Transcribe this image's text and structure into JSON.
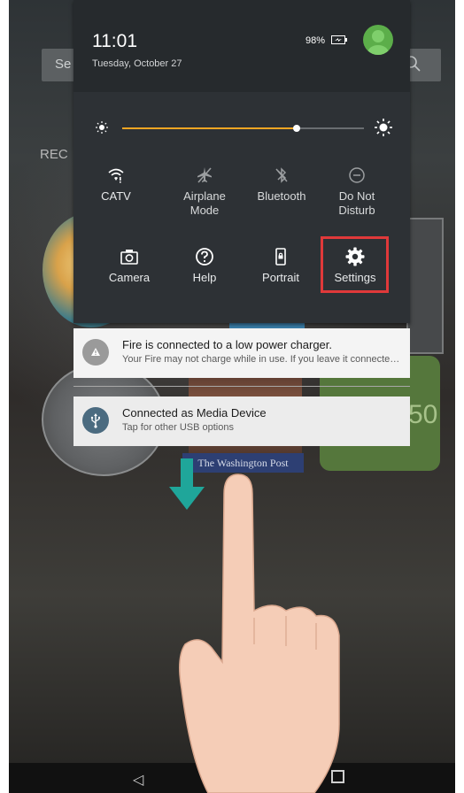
{
  "background": {
    "search_placeholder": "Se",
    "recent_label": "REC",
    "tile_text": "50",
    "magazine_title": "The Washington Post"
  },
  "status": {
    "time": "11:01",
    "date": "Tuesday, October 27",
    "battery": "98%"
  },
  "brightness": {
    "level": 0.72,
    "accent_color": "#f5a623"
  },
  "quick_settings": {
    "row1": [
      {
        "label": "CATV",
        "icon": "wifi-icon"
      },
      {
        "label": "Airplane Mode",
        "icon": "airplane-off-icon"
      },
      {
        "label": "Bluetooth",
        "icon": "bluetooth-off-icon"
      },
      {
        "label": "Do Not Disturb",
        "icon": "do-not-disturb-icon"
      }
    ],
    "row2": [
      {
        "label": "Camera",
        "icon": "camera-icon"
      },
      {
        "label": "Help",
        "icon": "help-icon"
      },
      {
        "label": "Portrait",
        "icon": "portrait-lock-icon"
      },
      {
        "label": "Settings",
        "icon": "gear-icon"
      }
    ],
    "highlight_color": "#e0393a"
  },
  "notifications": [
    {
      "title": "Fire is connected to a low power charger.",
      "body": "Your Fire may not charge while in use. If you leave it connected, it will charge slowly.",
      "icon": "warning-icon"
    },
    {
      "title": "Connected as Media Device",
      "body": "Tap for other USB options",
      "icon": "usb-icon"
    }
  ]
}
